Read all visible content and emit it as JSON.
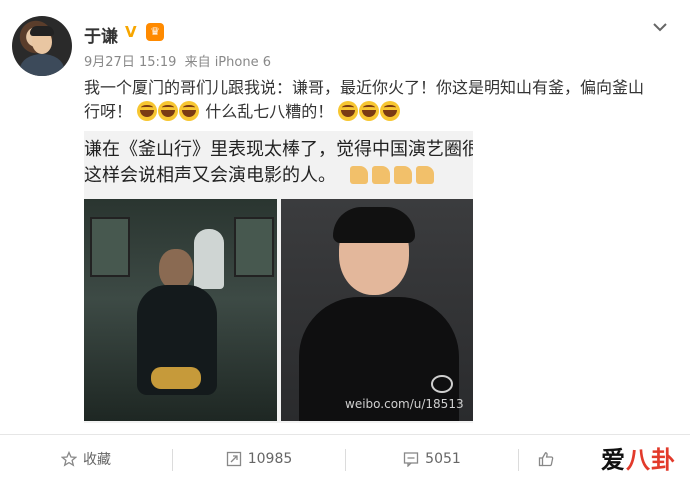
{
  "author": {
    "name": "于谦",
    "vip_mark": "V"
  },
  "meta": {
    "date": "9月27日 15:19",
    "source": "来自 iPhone 6"
  },
  "post": {
    "text_line1": "我一个厦门的哥们儿跟我说：谦哥，最近你火了！你这是明知山有釜，偏向釜山",
    "text_line2_a": "行呀！",
    "text_line2_b": "什么乱七八糟的！"
  },
  "embed": {
    "line1": "谦在《釜山行》里表现太棒了，觉得中国演艺圈很",
    "line2": "这样会说相声又会演电影的人。",
    "watermark": "weibo.com/u/18513"
  },
  "actions": {
    "favorite": "收藏",
    "repost": "10985",
    "comment": "5051",
    "like": ""
  },
  "site_logo": {
    "part1": "爱",
    "part2": "八卦"
  },
  "colors": {
    "vip": "#f7a600",
    "badge": "#ff8a00",
    "logo_accent": "#e23a2b"
  }
}
